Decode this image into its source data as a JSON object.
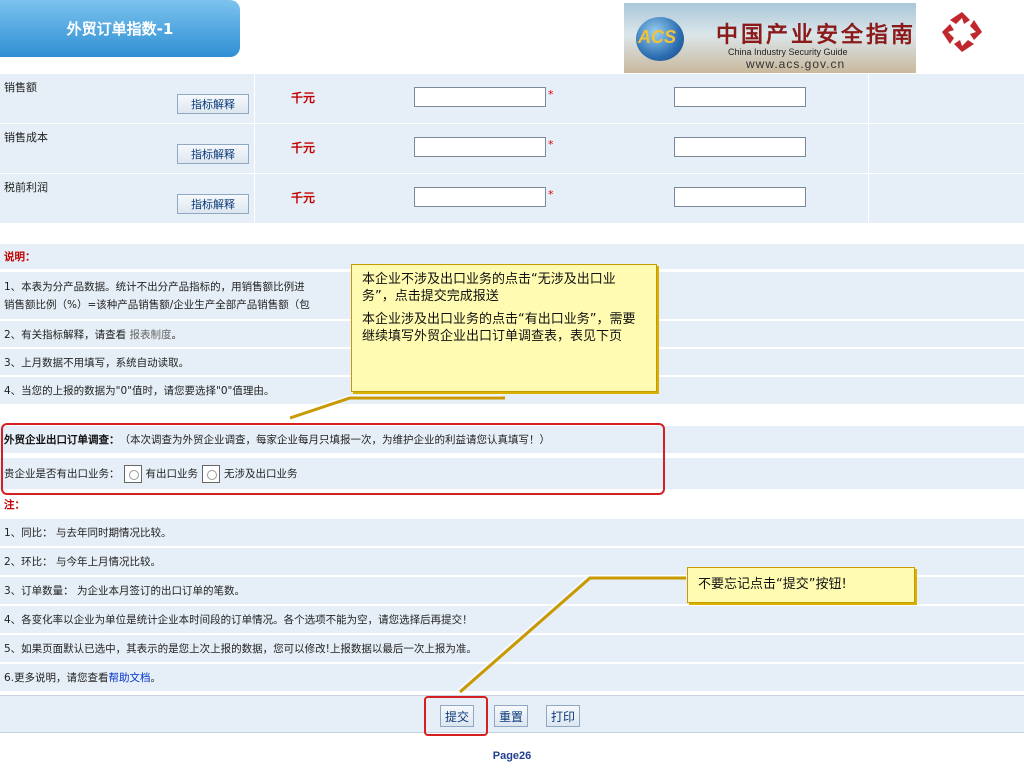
{
  "header": {
    "title": "外贸订单指数-1",
    "banner": {
      "acs": "ACS",
      "cn_title": "中国产业安全指南",
      "en_title": "China  Industry  Security  Guide",
      "url": "www.acs.gov.cn"
    }
  },
  "metrics": [
    {
      "name": "销售额",
      "button": "指标解释",
      "unit": "千元",
      "required": "*",
      "value": "",
      "value2": ""
    },
    {
      "name": "销售成本",
      "button": "指标解释",
      "unit": "千元",
      "required": "*",
      "value": "",
      "value2": ""
    },
    {
      "name": "税前利润",
      "button": "指标解释",
      "unit": "千元",
      "required": "*",
      "value": "",
      "value2": ""
    }
  ],
  "notes": {
    "title": "说明：",
    "line1a": "1、本表为分产品数据。统计不出分产品指标的，用销售额比例进",
    "line1b": "销售额比例（%）=该种产品销售额/企业生产全部产品销售额（包",
    "line2_prefix": "2、有关指标解释，请查看",
    "line2_link": "报表制度",
    "line2_suffix": "。",
    "line3": "3、上月数据不用填写，系统自动读取。",
    "line4": "4、当您的上报的数据为\"0\"值时，请您要选择\"0\"值理由。"
  },
  "survey": {
    "title": "外贸企业出口订单调查：",
    "desc": "（本次调查为外贸企业调查，每家企业每月只填报一次，为维护企业的利益请您认真填写！）",
    "question": "贵企业是否有出口业务：",
    "option_yes": "有出口业务",
    "option_no": "无涉及出口业务"
  },
  "footnotes": {
    "title": "注：",
    "items": [
      "1、同比：  与去年同时期情况比较。",
      "2、环比：  与今年上月情况比较。",
      "3、订单数量：  为企业本月签订的出口订单的笔数。",
      "4、各变化率以企业为单位是统计企业本时间段的订单情况。各个选项不能为空，请您选择后再提交！",
      "5、如果页面默认已选中，其表示的是您上次上报的数据，您可以修改!上报数据以最后一次上报为准。"
    ],
    "more_prefix": "6.更多说明，请您查看",
    "more_link": "帮助文档",
    "more_suffix": "。"
  },
  "callouts": {
    "survey_p1": "本企业不涉及出口业务的点击“无涉及出口业务”，点击提交完成报送",
    "survey_p2": "本企业涉及出口业务的点击“有出口业务”，需要继续填写外贸企业出口订单调查表，表见下页",
    "submit": "不要忘记点击“提交”按钮!"
  },
  "actions": {
    "submit": "提交",
    "reset": "重置",
    "print": "打印"
  },
  "page_number": "Page26",
  "colors": {
    "accent_red": "#d42020",
    "row_bg": "#e6eff7",
    "callout_bg": "#fffbb0",
    "link_blue": "#0033cc"
  }
}
